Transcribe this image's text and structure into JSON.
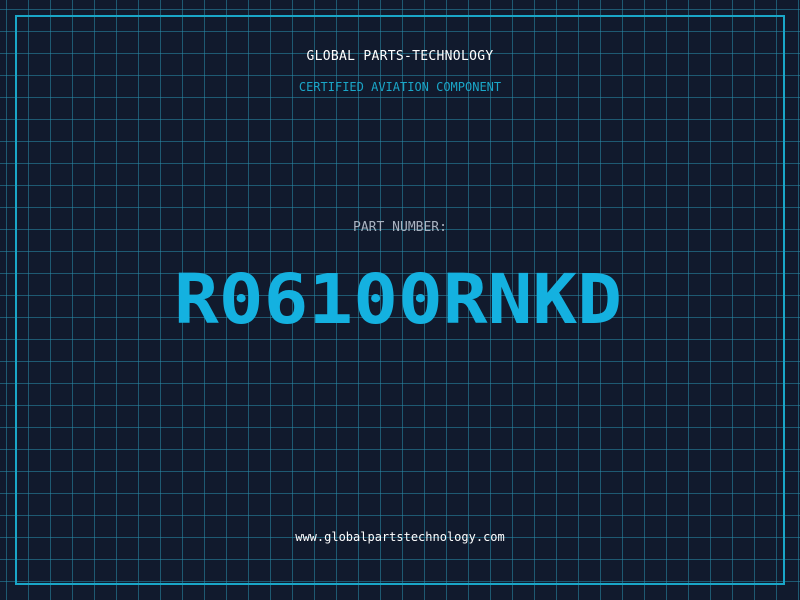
{
  "certificate": {
    "company": "GLOBAL PARTS-TECHNOLOGY",
    "tagline": "CERTIFIED AVIATION COMPONENT",
    "part_label": "PART NUMBER:",
    "part_number": "R06100RNKD",
    "website": "www.globalpartstechnology.com"
  },
  "colors": {
    "background": "#111a2d",
    "accent": "#1aa6c8",
    "part_number": "#14b1e0",
    "grid": "#288caa"
  }
}
